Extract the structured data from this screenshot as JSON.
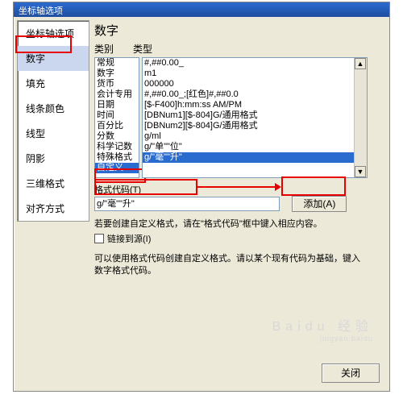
{
  "titlebar": "坐标轴选项",
  "sidebar": {
    "items": [
      {
        "label": "坐标轴选项"
      },
      {
        "label": "数字"
      },
      {
        "label": "填充"
      },
      {
        "label": "线条颜色"
      },
      {
        "label": "线型"
      },
      {
        "label": "阴影"
      },
      {
        "label": "三维格式"
      },
      {
        "label": "对齐方式"
      }
    ]
  },
  "main": {
    "heading": "数字",
    "category_label": "类别",
    "format_label": "类型",
    "categories": [
      "常规",
      "数字",
      "货币",
      "会计专用",
      "日期",
      "时间",
      "百分比",
      "分数",
      "科学记数",
      "特殊格式",
      "自定义"
    ],
    "formats": [
      "#,##0.00_",
      "       m1",
      "000000",
      "#,##0.00_;[红色]#,##0.0",
      "[$-F400]h:mm:ss AM/PM",
      "[DBNum1][$-804]G/通用格式",
      "[DBNum2][$-804]G/通用格式",
      "g/ml",
      "g/\"单\"\"位\"",
      "g/\"毫\"\"升\""
    ],
    "code_label": "格式代码(T)",
    "code_value": "g/\"毫\"\"升\"",
    "add_button": "添加(A)",
    "hint1": "若要创建自定义格式，请在\"格式代码\"框中键入相应内容。",
    "link_source": "链接到源(I)",
    "hint2": "可以使用格式代码创建自定义格式。请以某个现有代码为基础，键入数字格式代码。",
    "close": "关闭"
  },
  "watermark": {
    "line1": "Baidu 经验",
    "line2": "jingyan.baidu"
  }
}
